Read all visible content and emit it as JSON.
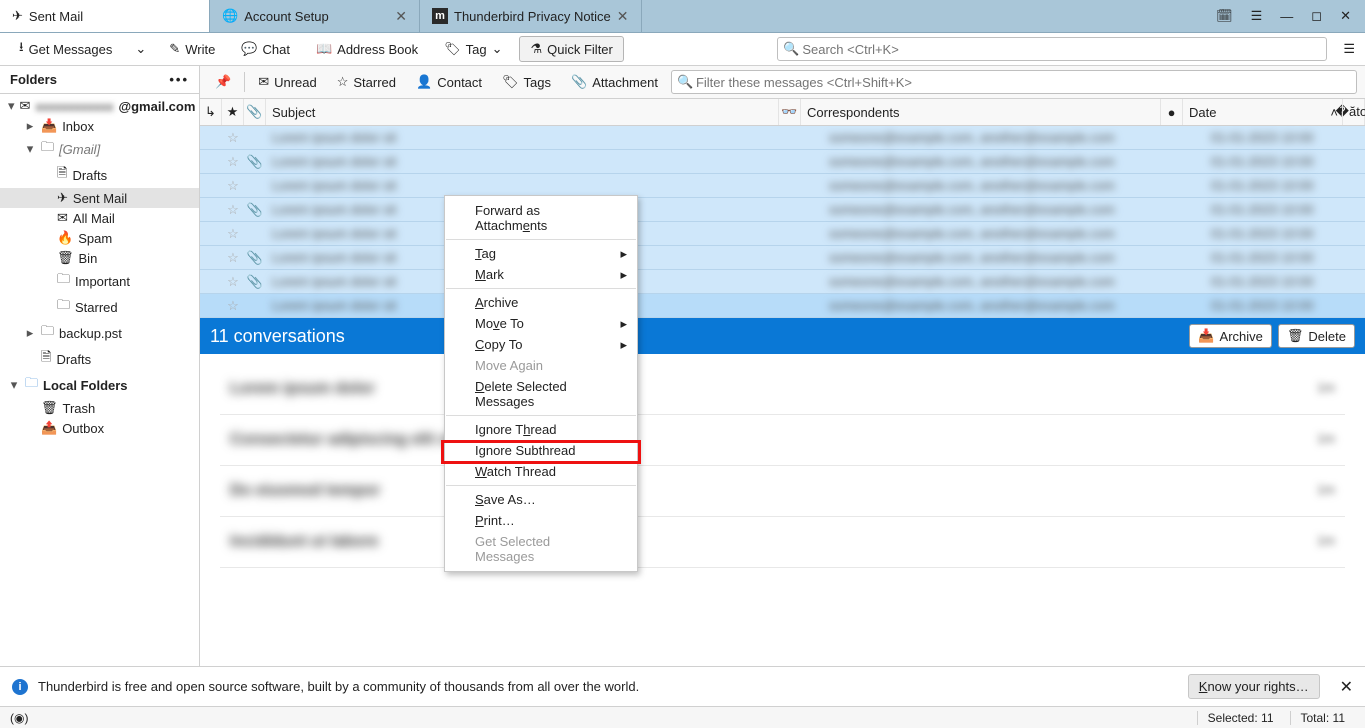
{
  "tabs": [
    {
      "label": "Sent Mail",
      "icon": "send"
    },
    {
      "label": "Account Setup",
      "icon": "globe",
      "closable": true
    },
    {
      "label": "Thunderbird Privacy Notice",
      "icon": "m",
      "closable": true
    }
  ],
  "toolbar": {
    "get_messages": "Get Messages",
    "write": "Write",
    "chat": "Chat",
    "address_book": "Address Book",
    "tag": "Tag",
    "quick_filter": "Quick Filter",
    "search_placeholder": "Search <Ctrl+K>"
  },
  "folder_pane": {
    "header": "Folders",
    "account": "@gmail.com",
    "items": [
      {
        "label": "Inbox",
        "icon": "inbox",
        "indent": 1,
        "twisty": "▸"
      },
      {
        "label": "[Gmail]",
        "icon": "folder",
        "indent": 1,
        "twisty": "▾",
        "gmail": true
      },
      {
        "label": "Drafts",
        "icon": "doc",
        "indent": 2
      },
      {
        "label": "Sent Mail",
        "icon": "send",
        "indent": 2,
        "selected": true
      },
      {
        "label": "All Mail",
        "icon": "mail",
        "indent": 2
      },
      {
        "label": "Spam",
        "icon": "fire",
        "indent": 2
      },
      {
        "label": "Bin",
        "icon": "trash",
        "indent": 2
      },
      {
        "label": "Important",
        "icon": "folder",
        "indent": 2
      },
      {
        "label": "Starred",
        "icon": "folder",
        "indent": 2
      },
      {
        "label": "backup.pst",
        "icon": "folder",
        "indent": 1,
        "twisty": "▸"
      },
      {
        "label": "Drafts",
        "icon": "doc",
        "indent": 1
      }
    ],
    "local": {
      "label": "Local Folders",
      "items": [
        {
          "label": "Trash",
          "icon": "trash"
        },
        {
          "label": "Outbox",
          "icon": "out"
        }
      ]
    }
  },
  "filter_bar": {
    "unread": "Unread",
    "starred": "Starred",
    "contact": "Contact",
    "tags": "Tags",
    "attachment": "Attachment",
    "placeholder": "Filter these messages <Ctrl+Shift+K>"
  },
  "columns": {
    "subject": "Subject",
    "correspondents": "Correspondents",
    "date": "Date"
  },
  "message_rows": 8,
  "conversation_bar": {
    "text": "11 conversations",
    "archive": "Archive",
    "delete": "Delete"
  },
  "context_menu": [
    {
      "label_html": "Forward as Attachm<u>e</u>nts"
    },
    {
      "sep": true
    },
    {
      "label_html": "<u>T</u>ag",
      "sub": true
    },
    {
      "label_html": "<u>M</u>ark",
      "sub": true
    },
    {
      "sep": true
    },
    {
      "label_html": "<u>A</u>rchive"
    },
    {
      "label_html": "Mo<u>v</u>e To",
      "sub": true
    },
    {
      "label_html": "<u>C</u>opy To",
      "sub": true
    },
    {
      "label_html": "Move A<u>g</u>ain",
      "disabled": true
    },
    {
      "label_html": "<u>D</u>elete Selected Messages"
    },
    {
      "sep": true
    },
    {
      "label_html": "Ignore T<u>h</u>read"
    },
    {
      "label_html": "Ignore Subthread"
    },
    {
      "label_html": "<u>W</u>atch Thread"
    },
    {
      "sep": true
    },
    {
      "label_html": "<u>S</u>ave As…",
      "highlight": true
    },
    {
      "label_html": "<u>P</u>rint…"
    },
    {
      "label_html": "Get Selected Messages",
      "disabled": true
    }
  ],
  "info": {
    "text": "Thunderbird is free and open source software, built by a community of thousands from all over the world.",
    "know": "Know your rights…"
  },
  "status": {
    "selected_label": "Selected:",
    "selected": "11",
    "total_label": "Total:",
    "total": "11"
  }
}
